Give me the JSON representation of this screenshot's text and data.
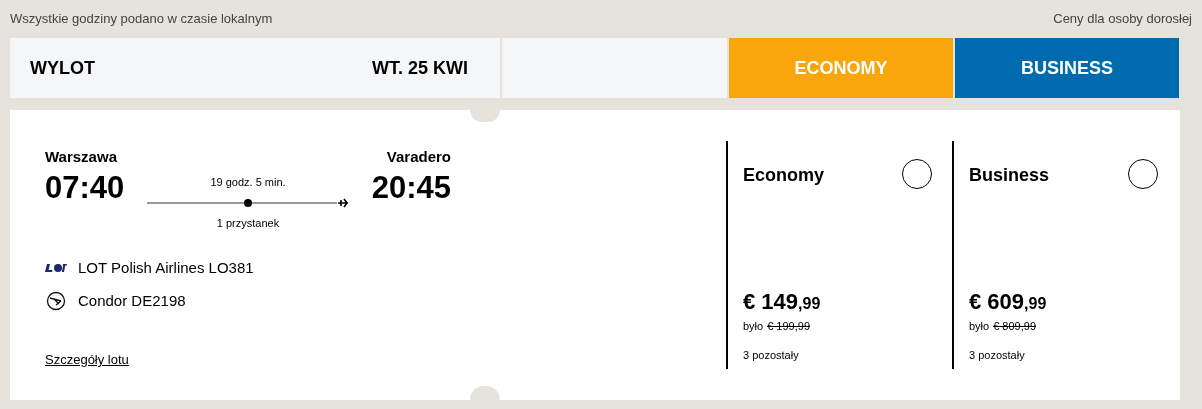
{
  "notes": {
    "left": "Wszystkie godziny podano w czasie lokalnym",
    "right": "Ceny dla osoby dorosłej"
  },
  "header": {
    "label": "WYLOT",
    "date": "WT. 25 KWI",
    "cabins": [
      {
        "label": "ECONOMY",
        "color": "#f9a50c"
      },
      {
        "label": "BUSINESS",
        "color": "#006aae"
      }
    ]
  },
  "flight": {
    "departure": {
      "city": "Warszawa",
      "time": "07:40"
    },
    "arrival": {
      "city": "Varadero",
      "time": "20:45"
    },
    "duration": "19 godz. 5 min.",
    "stops": "1 przystanek",
    "carriers": [
      {
        "kind": "lot",
        "name": "LOT Polish Airlines LO381"
      },
      {
        "kind": "condor",
        "name": "Condor DE2198"
      }
    ],
    "details_link": "Szczegóły lotu"
  },
  "fares": [
    {
      "name": "Economy",
      "selected": false,
      "price": "€ 149",
      "cents": ",99",
      "was_label": "było",
      "was_price": "€ 199,99",
      "remaining": "3 pozostały"
    },
    {
      "name": "Business",
      "selected": false,
      "price": "€ 609",
      "cents": ",99",
      "was_label": "było",
      "was_price": "€ 809,99",
      "remaining": "3 pozostały"
    }
  ]
}
